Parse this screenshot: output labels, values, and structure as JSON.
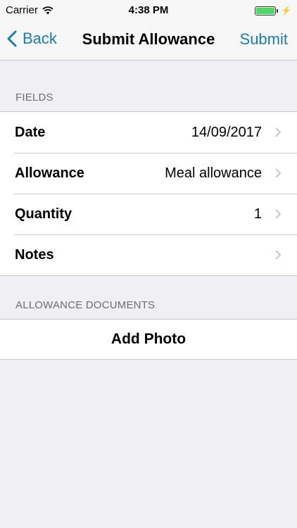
{
  "status_bar": {
    "carrier": "Carrier",
    "time": "4:38 PM"
  },
  "nav": {
    "back_label": "Back",
    "title": "Submit Allowance",
    "submit_label": "Submit"
  },
  "fields_section": {
    "header": "FIELDS",
    "rows": [
      {
        "label": "Date",
        "value": "14/09/2017"
      },
      {
        "label": "Allowance",
        "value": "Meal allowance"
      },
      {
        "label": "Quantity",
        "value": "1"
      },
      {
        "label": "Notes",
        "value": ""
      }
    ]
  },
  "documents_section": {
    "header": "ALLOWANCE DOCUMENTS",
    "add_photo_label": "Add Photo"
  },
  "colors": {
    "accent": "#1a7bb9",
    "battery": "#4cd964",
    "background": "#efeff4"
  }
}
